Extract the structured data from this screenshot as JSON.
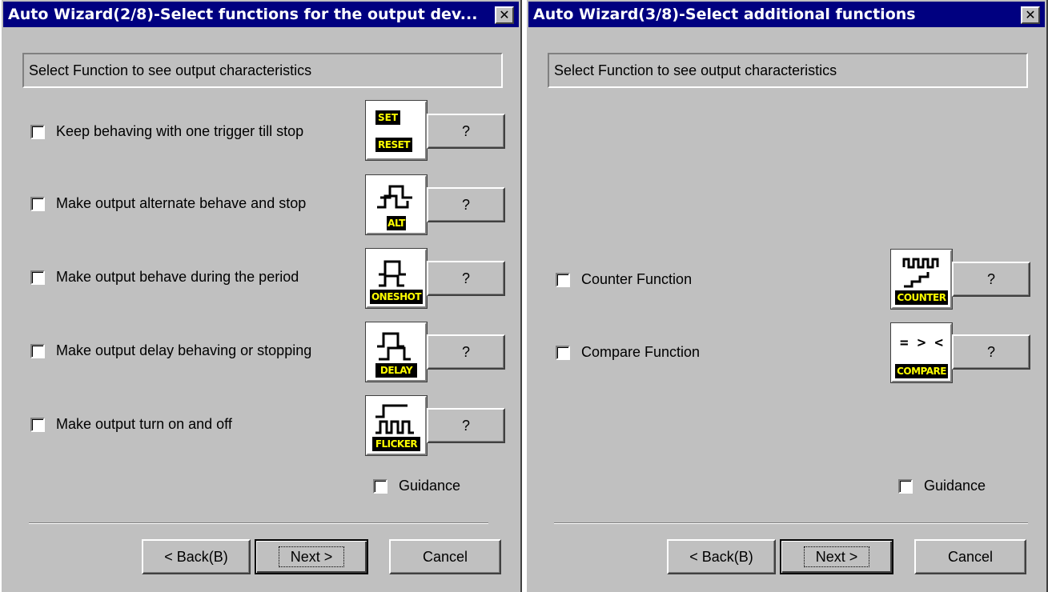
{
  "dialogs": [
    {
      "title": "Auto Wizard(2/8)-Select functions for the output dev...",
      "close_glyph": "✕",
      "info_text": "Select Function to see output characteristics",
      "functions": [
        {
          "label": "Keep behaving with one trigger till stop",
          "icon": "set-reset-icon",
          "icon_text_top": "SET",
          "icon_text": "RESET",
          "help_label": "?"
        },
        {
          "label": "Make output alternate behave and stop",
          "icon": "alt-icon",
          "icon_text": "ALT",
          "help_label": "?"
        },
        {
          "label": "Make output behave during the period",
          "icon": "oneshot-icon",
          "icon_text": "ONESHOT",
          "help_label": "?"
        },
        {
          "label": "Make output delay behaving or stopping",
          "icon": "delay-icon",
          "icon_text": "DELAY",
          "help_label": "?"
        },
        {
          "label": "Make output turn on and off",
          "icon": "flicker-icon",
          "icon_text": "FLICKER",
          "help_label": "?"
        }
      ],
      "guidance_label": "Guidance",
      "buttons": {
        "back": "< Back(B)",
        "next": "Next >",
        "cancel": "Cancel"
      }
    },
    {
      "title": "Auto Wizard(3/8)-Select additional functions",
      "close_glyph": "✕",
      "info_text": "Select Function to see output characteristics",
      "functions": [
        {
          "label": "Counter Function",
          "icon": "counter-icon",
          "icon_text": "COUNTER",
          "help_label": "?"
        },
        {
          "label": "Compare Function",
          "icon": "compare-icon",
          "icon_text": "COMPARE",
          "icon_symbol": "= > <",
          "help_label": "?"
        }
      ],
      "guidance_label": "Guidance",
      "buttons": {
        "back": "< Back(B)",
        "next": "Next >",
        "cancel": "Cancel"
      }
    }
  ]
}
